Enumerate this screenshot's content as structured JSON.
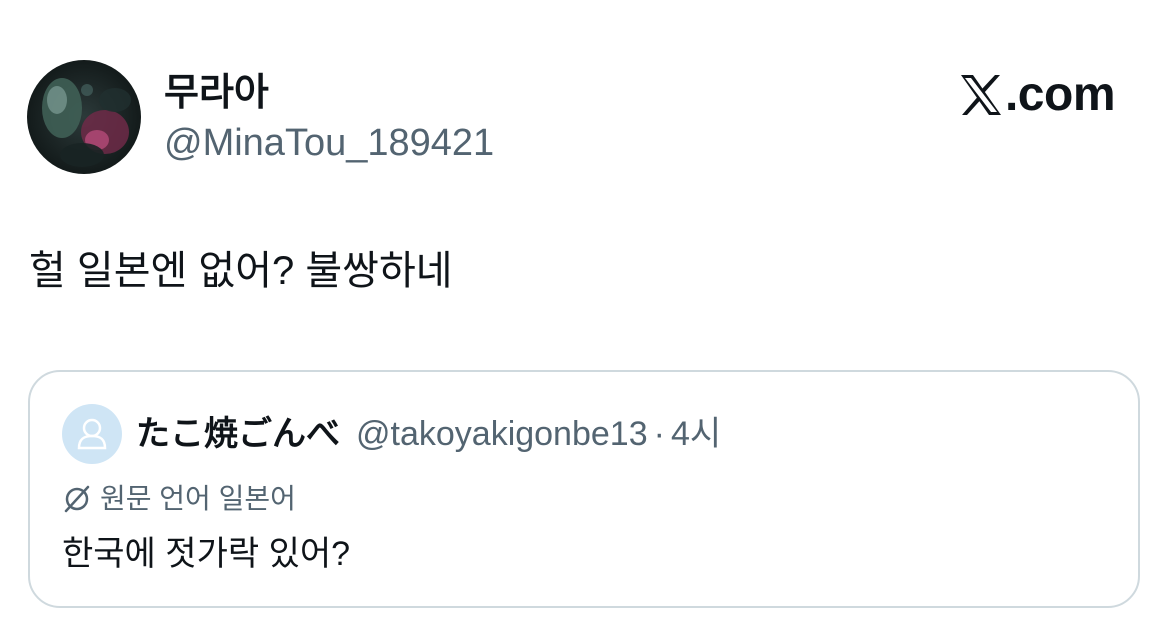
{
  "author": {
    "display_name": "무라아",
    "handle": "@MinaTou_189421",
    "avatar": "profile-photo"
  },
  "brand": {
    "label": ".com",
    "icon": "x-logo-icon"
  },
  "tweet": {
    "text": "헐 일본엔 없어? 불쌍하네"
  },
  "quote": {
    "display_name": "たこ焼ごんべ",
    "handle": "@takoyakigonbe13",
    "separator": "·",
    "time": "4시",
    "avatar": "default-avatar-icon",
    "translation_note": "원문 언어 일본어",
    "translation_icon": "translate-icon",
    "text": "한국에 젓가락 있어?"
  },
  "colors": {
    "text_primary": "#0f1419",
    "text_secondary": "#536471",
    "border": "#cfd9de",
    "default_avatar_bg": "#cfe5f5"
  }
}
